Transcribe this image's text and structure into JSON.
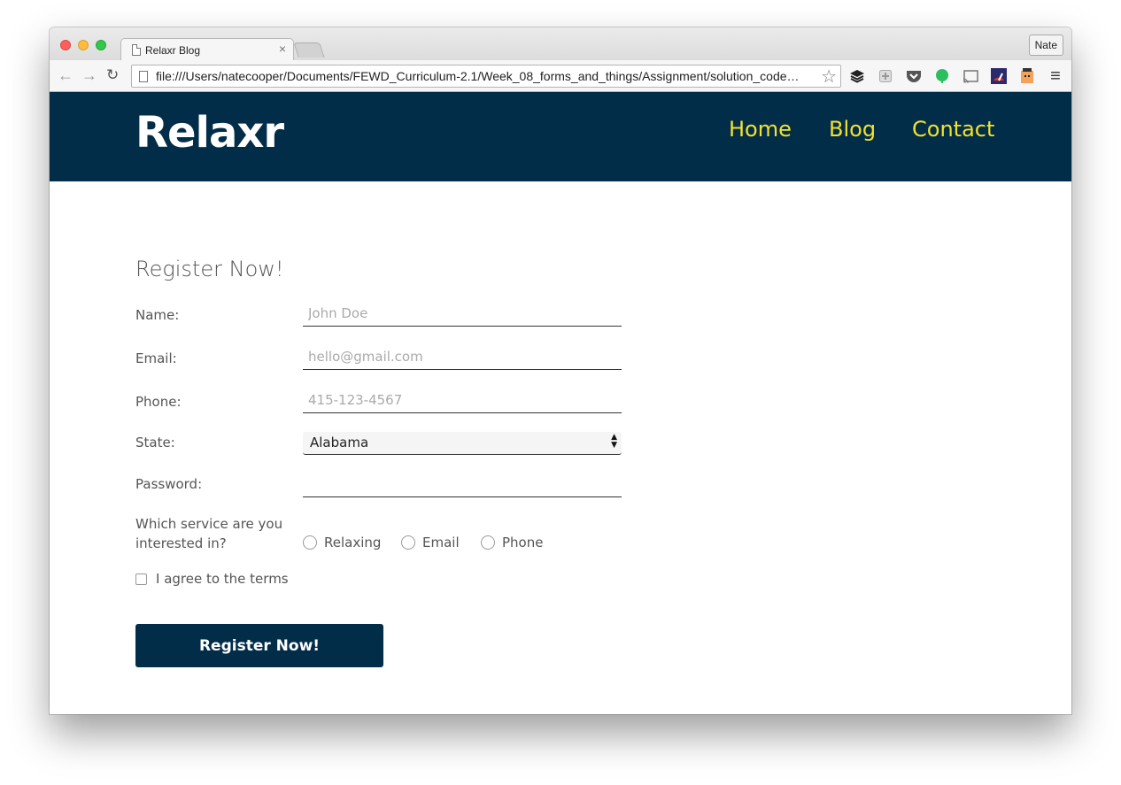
{
  "browser": {
    "tab_title": "Relaxr Blog",
    "tab_close": "×",
    "profile_name": "Nate",
    "url": "file:///Users/natecooper/Documents/FEWD_Curriculum-2.1/Week_08_forms_and_things/Assignment/solution_code…",
    "back_icon": "←",
    "forward_icon": "→",
    "reload_icon": "↻",
    "star_icon": "☆",
    "menu_icon": "≡"
  },
  "header": {
    "logo": "Relaxr",
    "nav": [
      "Home",
      "Blog",
      "Contact"
    ]
  },
  "form": {
    "heading": "Register Now!",
    "name": {
      "label": "Name:",
      "placeholder": "John Doe"
    },
    "email": {
      "label": "Email:",
      "placeholder": "hello@gmail.com"
    },
    "phone": {
      "label": "Phone:",
      "placeholder": "415-123-4567"
    },
    "state": {
      "label": "State:",
      "value": "Alabama"
    },
    "password": {
      "label": "Password:"
    },
    "service": {
      "label_line1": "Which service are you",
      "label_line2": "interested in?",
      "options": [
        "Relaxing",
        "Email",
        "Phone"
      ]
    },
    "terms_label": "I agree to the terms",
    "submit_label": "Register Now!"
  },
  "colors": {
    "header_bg": "#022d49",
    "nav_link": "#f2e12d",
    "button_bg": "#022d49"
  }
}
